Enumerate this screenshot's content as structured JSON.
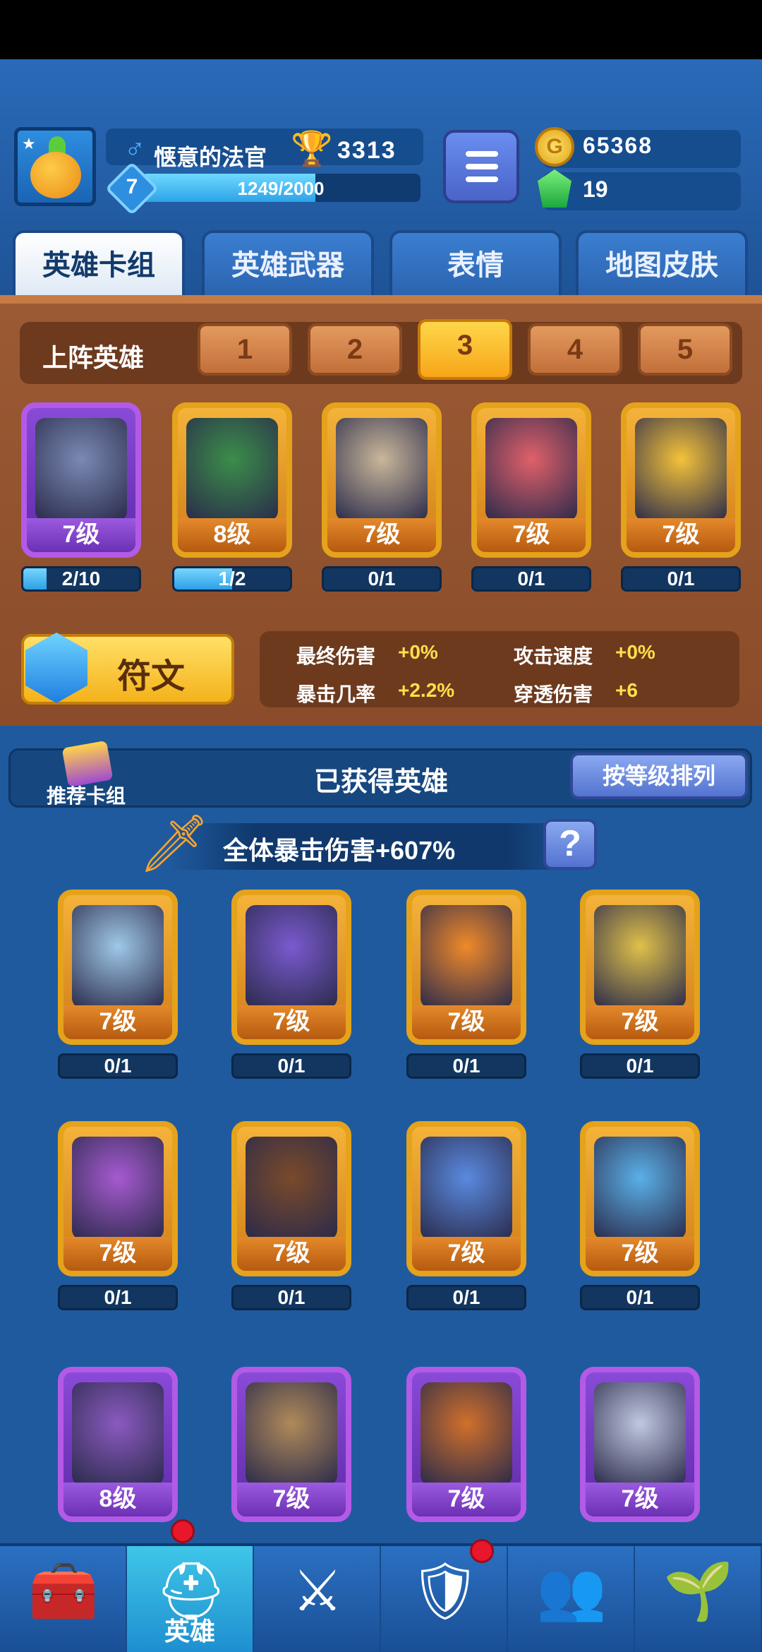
{
  "player": {
    "name": "惬意的法官",
    "level": "7",
    "xp_text": "1249/2000",
    "xp_fraction": 0.6245,
    "trophies": "3313"
  },
  "currency": {
    "coins": "65368",
    "gems": "19"
  },
  "tabs": [
    {
      "label": "英雄卡组",
      "active": true
    },
    {
      "label": "英雄武器",
      "active": false
    },
    {
      "label": "表情",
      "active": false
    },
    {
      "label": "地图皮肤",
      "active": false
    }
  ],
  "deck": {
    "title": "上阵英雄",
    "slots": [
      "1",
      "2",
      "3",
      "4",
      "5"
    ],
    "active_slot": "3",
    "heroes": [
      {
        "level": "7级",
        "progress": "2/10",
        "fraction": 0.2,
        "rarity": "epic",
        "art": "#7a8ab4"
      },
      {
        "level": "8级",
        "progress": "1/2",
        "fraction": 0.5,
        "rarity": "legendary",
        "art": "#3b8e4a"
      },
      {
        "level": "7级",
        "progress": "0/1",
        "fraction": 0,
        "rarity": "legendary",
        "art": "#c9b79a"
      },
      {
        "level": "7级",
        "progress": "0/1",
        "fraction": 0,
        "rarity": "legendary",
        "art": "#e0606a"
      },
      {
        "level": "7级",
        "progress": "0/1",
        "fraction": 0,
        "rarity": "legendary",
        "art": "#f4c23a"
      }
    ]
  },
  "rune": {
    "label": "符文"
  },
  "stats": [
    {
      "label": "最终伤害",
      "value": "+0%"
    },
    {
      "label": "攻击速度",
      "value": "+0%"
    },
    {
      "label": "暴击几率",
      "value": "+2.2%"
    },
    {
      "label": "穿透伤害",
      "value": "+6"
    }
  ],
  "owned": {
    "recommend_label": "推荐卡组",
    "title": "已获得英雄",
    "sort_label": "按等级排列",
    "crit_bonus": "全体暴击伤害+607%",
    "help_label": "?",
    "heroes": [
      {
        "level": "7级",
        "progress": "0/1",
        "rarity": "legendary",
        "art": "#9fc8e8"
      },
      {
        "level": "7级",
        "progress": "0/1",
        "rarity": "legendary",
        "art": "#7a5acf"
      },
      {
        "level": "7级",
        "progress": "0/1",
        "rarity": "legendary",
        "art": "#f0892a"
      },
      {
        "level": "7级",
        "progress": "0/1",
        "rarity": "legendary",
        "art": "#e0c04a"
      },
      {
        "level": "7级",
        "progress": "0/1",
        "rarity": "legendary",
        "art": "#a65ad0"
      },
      {
        "level": "7级",
        "progress": "0/1",
        "rarity": "legendary",
        "art": "#7a4a2a"
      },
      {
        "level": "7级",
        "progress": "0/1",
        "rarity": "legendary",
        "art": "#5a8ae0"
      },
      {
        "level": "7级",
        "progress": "0/1",
        "rarity": "legendary",
        "art": "#5ab0e8"
      },
      {
        "level": "8级",
        "rarity": "epic",
        "art": "#8a5ac0"
      },
      {
        "level": "7级",
        "rarity": "epic",
        "art": "#b08a5a"
      },
      {
        "level": "7级",
        "rarity": "epic",
        "art": "#d0702a"
      },
      {
        "level": "7级",
        "rarity": "epic",
        "art": "#c0c8e0"
      }
    ]
  },
  "nav": [
    {
      "icon": "treasure-chest-icon",
      "label": "",
      "active": false,
      "badge": false
    },
    {
      "icon": "knight-helmet-icon",
      "label": "英雄",
      "active": true,
      "badge": true
    },
    {
      "icon": "crossed-swords-icon",
      "label": "",
      "active": false,
      "badge": false
    },
    {
      "icon": "crown-shield-icon",
      "label": "",
      "active": false,
      "badge": true
    },
    {
      "icon": "friends-icon",
      "label": "",
      "active": false,
      "badge": false
    },
    {
      "icon": "sprout-garden-icon",
      "label": "",
      "active": false,
      "badge": false
    }
  ]
}
